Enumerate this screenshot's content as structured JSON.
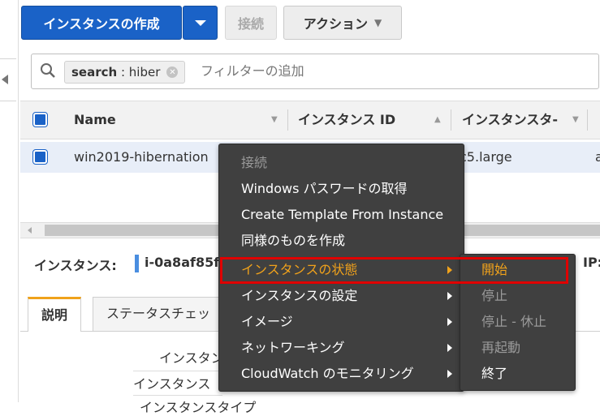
{
  "toolbar": {
    "create_label": "インスタンスの作成",
    "connect_label": "接続",
    "action_label": "アクション"
  },
  "search": {
    "token_key": "search",
    "token_sep": " : ",
    "token_value": "hiber",
    "placeholder": "フィルターの追加"
  },
  "table": {
    "columns": [
      "Name",
      "インスタンス ID",
      "インスタンスタ-"
    ],
    "row": {
      "name": "win2019-hibernation",
      "type": "c5.large",
      "extra": "a"
    }
  },
  "detail": {
    "instance_label": "インスタンス:",
    "instance_id": "i-0a8af85f7",
    "ip_label": "IP:"
  },
  "tabs": [
    "説明",
    "ステータスチェッ"
  ],
  "description": {
    "label_1": "インスタン",
    "label_2": "インスタンス",
    "label_3": "インスタンスタイプ"
  },
  "context_menu": {
    "items": [
      {
        "label": "接続",
        "state": "disabled"
      },
      {
        "label": "Windows パスワードの取得",
        "state": "normal"
      },
      {
        "label": "Create Template From Instance",
        "state": "normal"
      },
      {
        "label": "同様のものを作成",
        "state": "normal"
      },
      {
        "label": "インスタンスの状態",
        "state": "active"
      },
      {
        "label": "インスタンスの設定",
        "state": "normal"
      },
      {
        "label": "イメージ",
        "state": "normal"
      },
      {
        "label": "ネットワーキング",
        "state": "normal"
      },
      {
        "label": "CloudWatch のモニタリング",
        "state": "normal"
      }
    ],
    "submenu": [
      {
        "label": "開始",
        "state": "active"
      },
      {
        "label": "停止",
        "state": "disabled"
      },
      {
        "label": "停止 - 休止",
        "state": "disabled"
      },
      {
        "label": "再起動",
        "state": "disabled"
      },
      {
        "label": "終了",
        "state": "normal"
      }
    ]
  },
  "colors": {
    "primary_button": "#1a62c7",
    "menu_background": "#404040",
    "active_text": "#f0a21b",
    "highlight": "#e00000"
  }
}
